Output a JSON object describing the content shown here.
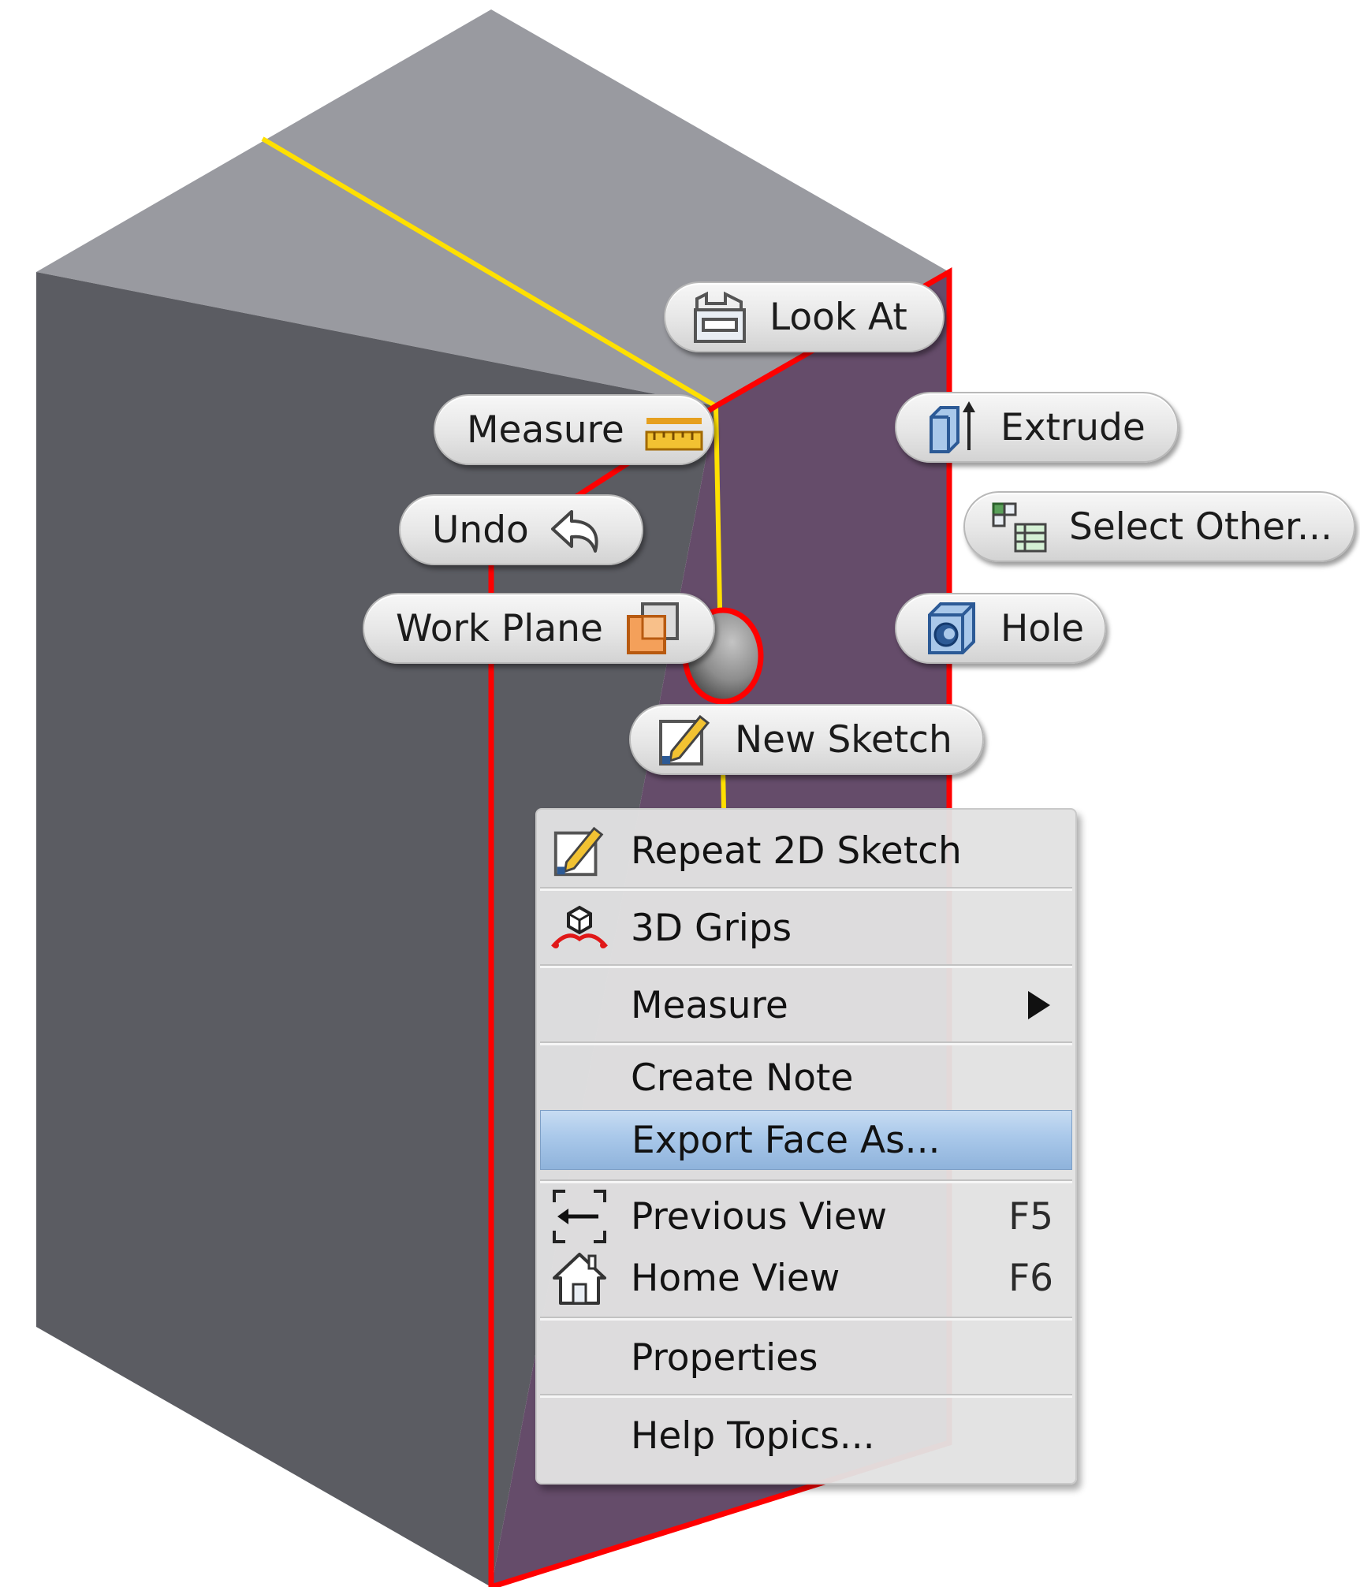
{
  "marking_menu": {
    "look_at": "Look At",
    "measure": "Measure",
    "extrude": "Extrude",
    "undo": "Undo",
    "select_other": "Select Other...",
    "work_plane": "Work Plane",
    "hole": "Hole",
    "new_sketch": "New Sketch"
  },
  "context_menu": {
    "items": [
      {
        "label": "Repeat 2D Sketch",
        "icon": "sketch-pencil-icon"
      },
      {
        "label": "3D Grips",
        "icon": "3d-grips-icon"
      },
      {
        "label": "Measure",
        "submenu": true
      },
      {
        "label": "Create Note"
      },
      {
        "label": "Export Face As...",
        "highlighted": true
      },
      {
        "label": "Previous View",
        "shortcut": "F5",
        "icon": "previous-view-icon"
      },
      {
        "label": "Home View",
        "shortcut": "F6",
        "icon": "home-view-icon"
      },
      {
        "label": "Properties"
      },
      {
        "label": "Help Topics..."
      }
    ]
  },
  "colors": {
    "top_face": "#999aa0",
    "left_face": "#5b5c62",
    "selected_face": "#654c6a",
    "selection_edge": "#ff0000",
    "highlight_edge": "#ffe000",
    "menu_highlight": "#a9c8ea"
  }
}
